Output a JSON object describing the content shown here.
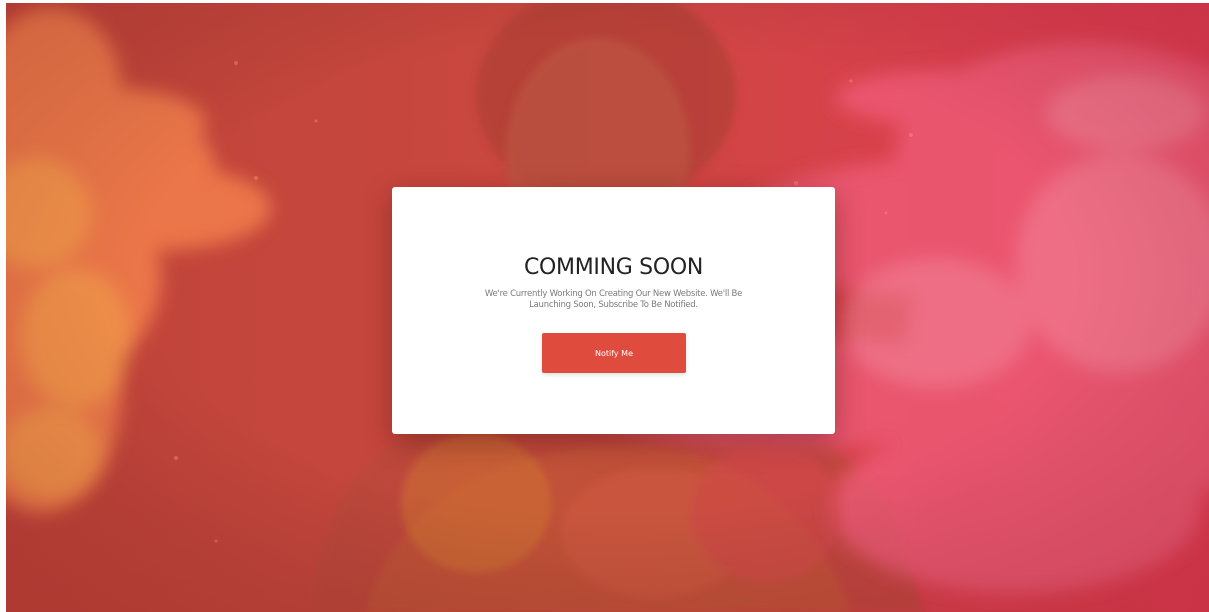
{
  "page": {
    "title": "COMMING SOON",
    "description": "We're Currently Working On Creating Our New Website. We'll Be Launching Soon, Subscribe To Be Notified.",
    "button_label": "Notify Me"
  },
  "theme": {
    "overlay_left": "#c0433a",
    "overlay_right": "#e23b52",
    "accent": "#df4c3d",
    "card_background": "#ffffff"
  },
  "background": {
    "image_subject": "person-with-color-powder"
  }
}
